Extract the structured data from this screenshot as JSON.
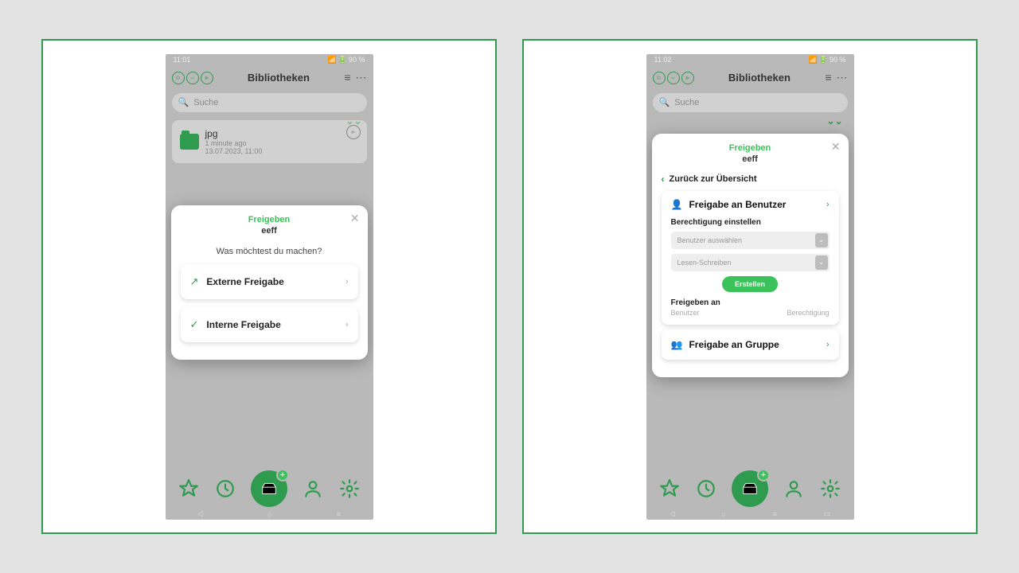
{
  "screens": {
    "left": {
      "status": {
        "time": "11:01",
        "battery": "90 %"
      },
      "header": {
        "title": "Bibliotheken"
      },
      "search": {
        "placeholder": "Suche"
      },
      "file": {
        "name": "jpg",
        "ago": "1 minute ago",
        "date": "13.07.2023, 11:00"
      },
      "modal": {
        "title": "Freigeben",
        "subtitle": "eeff",
        "question": "Was möchtest du machen?",
        "opt1": "Externe Freigabe",
        "opt2": "Interne Freigabe"
      }
    },
    "right": {
      "status": {
        "time": "11:02",
        "battery": "90 %"
      },
      "header": {
        "title": "Bibliotheken"
      },
      "search": {
        "placeholder": "Suche"
      },
      "modal": {
        "title": "Freigeben",
        "subtitle": "eeff",
        "back": "Zurück zur Übersicht",
        "user_card": {
          "heading": "Freigabe an Benutzer",
          "section": "Berechtigung einstellen",
          "select_user": "Benutzer auswählen",
          "select_perm": "Lesen-Schreiben",
          "create": "Erstellen",
          "share_to": "Freigeben an",
          "col_user": "Benutzer",
          "col_perm": "Berechtigung"
        },
        "group_card": {
          "heading": "Freigabe an Gruppe"
        }
      }
    }
  }
}
